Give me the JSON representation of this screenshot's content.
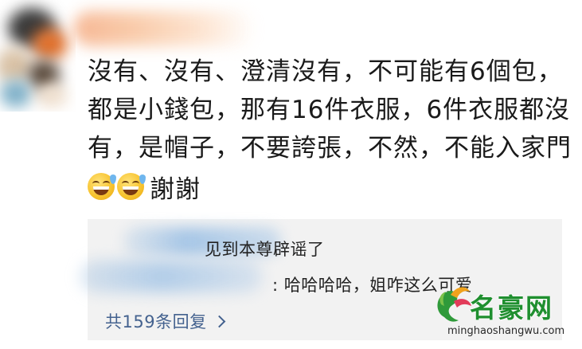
{
  "comment": {
    "lines": [
      "沒有、沒有、澄清沒有，不可能有6個包，",
      "都是小錢包，那有16件衣服，6件衣服都沒",
      "有，是帽子，不要誇張，不然，不能入家門"
    ],
    "emoji_icon": "grinning-sweat-emoji",
    "trailing_text": "謝謝"
  },
  "replies": {
    "items": [
      {
        "text": "见到本尊辟谣了"
      },
      {
        "text": ": 哈哈哈哈，姐咋这么可爱"
      }
    ],
    "count_label": "共159条回复"
  },
  "watermark": {
    "title": "名豪网",
    "url": "minghaoshangwu.com"
  },
  "colors": {
    "link": "#44628f",
    "reply_bg": "#f2f2f2",
    "watermark_green": "#1f8f2f"
  }
}
